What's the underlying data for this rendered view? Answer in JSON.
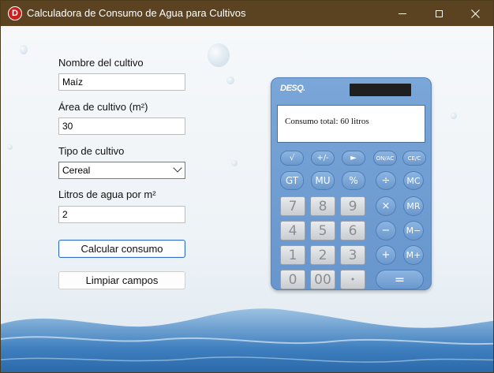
{
  "window": {
    "title": "Calculadora de Consumo de Agua para Cultivos",
    "app_icon_letter": "D"
  },
  "form": {
    "crop_name_label": "Nombre del cultivo",
    "crop_name_value": "Maíz",
    "area_label": "Área de cultivo (m²)",
    "area_value": "30",
    "crop_type_label": "Tipo de cultivo",
    "crop_type_value": "Cereal",
    "liters_label": "Litros de agua por m²",
    "liters_value": "2",
    "calculate_button": "Calcular consumo",
    "clear_button": "Limpiar campos"
  },
  "calculator": {
    "brand": "DESQ.",
    "display_text": "Consumo total: 60 litros",
    "keys": {
      "sqrt": "√",
      "plusminus": "+/-",
      "arrow": "►",
      "onac": "ON/AC",
      "ce": "CE/C",
      "gt": "GT",
      "mu": "MU",
      "pct": "%",
      "div": "÷",
      "mc": "MC",
      "seven": "7",
      "eight": "8",
      "nine": "9",
      "mul": "×",
      "mr": "MR",
      "four": "4",
      "five": "5",
      "six": "6",
      "minus": "−",
      "mminus": "M−",
      "one": "1",
      "two": "2",
      "three": "3",
      "plus": "+",
      "mplus": "M+",
      "zero": "0",
      "doublezero": "00",
      "dot": "•",
      "equals": "="
    }
  },
  "colors": {
    "titlebar": "#5b4321",
    "primary_button_border": "#2b6ac9",
    "calculator_body": "#6f9dd2"
  }
}
